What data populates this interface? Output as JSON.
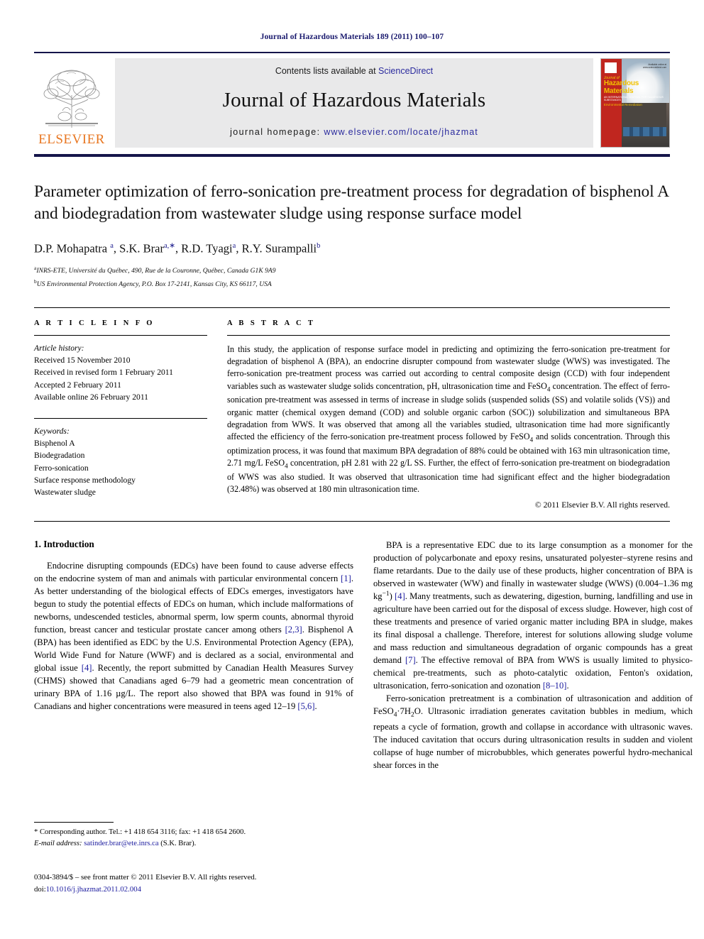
{
  "running_head": "Journal of Hazardous Materials 189 (2011) 100–107",
  "masthead": {
    "contents_prefix": "Contents lists available at ",
    "sciencedirect": "ScienceDirect",
    "journal_title": "Journal of Hazardous Materials",
    "homepage_prefix": "journal homepage:",
    "homepage_url": "www.elsevier.com/locate/jhazmat",
    "publisher": "ELSEVIER",
    "cover": {
      "line1": "Journal of",
      "line2": "Hazardous",
      "line3": "Materials",
      "line4": "AN INTERNATIONAL JOURNAL FOR HAZARDOUS SUBSTANCES",
      "line5": "Environmental Remediation",
      "corner_note": "Available online at www.sciencedirect.com"
    },
    "accent_blue": "#2b2b9e",
    "accent_orange": "#e87722",
    "rule_navy": "#15154a"
  },
  "article": {
    "title": "Parameter optimization of ferro-sonication pre-treatment process for degradation of bisphenol A and biodegradation from wastewater sludge using response surface model",
    "authors_html": "D.P. Mohapatra <sup>a</sup>, S.K. Brar<sup>a,∗</sup>, R.D. Tyagi<sup>a</sup>, R.Y. Surampalli<sup>b</sup>",
    "affiliations": [
      {
        "marker": "a",
        "text": "INRS-ETE, Université du Québec, 490, Rue de la Couronne, Québec, Canada G1K 9A9"
      },
      {
        "marker": "b",
        "text": "US Environmental Protection Agency, P.O. Box 17-2141, Kansas City, KS 66117, USA"
      }
    ]
  },
  "article_info": {
    "heading": "A R T I C L E  I N F O",
    "history_label": "Article history:",
    "history": [
      "Received 15 November 2010",
      "Received in revised form 1 February 2011",
      "Accepted 2 February 2011",
      "Available online 26 February 2011"
    ],
    "keywords_label": "Keywords:",
    "keywords": [
      "Bisphenol A",
      "Biodegradation",
      "Ferro-sonication",
      "Surface response methodology",
      "Wastewater sludge"
    ]
  },
  "abstract": {
    "heading": "A B S T R A C T",
    "text": "In this study, the application of response surface model in predicting and optimizing the ferro-sonication pre-treatment for degradation of bisphenol A (BPA), an endocrine disrupter compound from wastewater sludge (WWS) was investigated. The ferro-sonication pre-treatment process was carried out according to central composite design (CCD) with four independent variables such as wastewater sludge solids concentration, pH, ultrasonication time and FeSO4 concentration. The effect of ferro-sonication pre-treatment was assessed in terms of increase in sludge solids (suspended solids (SS) and volatile solids (VS)) and organic matter (chemical oxygen demand (COD) and soluble organic carbon (SOC)) solubilization and simultaneous BPA degradation from WWS. It was observed that among all the variables studied, ultrasonication time had more significantly affected the efficiency of the ferro-sonication pre-treatment process followed by FeSO4 and solids concentration. Through this optimization process, it was found that maximum BPA degradation of 88% could be obtained with 163 min ultrasonication time, 2.71 mg/L FeSO4 concentration, pH 2.81 with 22 g/L SS. Further, the effect of ferro-sonication pre-treatment on biodegradation of WWS was also studied. It was observed that ultrasonication time had significant effect and the higher biodegradation (32.48%) was observed at 180 min ultrasonication time.",
    "copyright": "© 2011 Elsevier B.V. All rights reserved."
  },
  "introduction": {
    "heading": "1.  Introduction",
    "left_paragraphs": [
      "Endocrine disrupting compounds (EDCs) have been found to cause adverse effects on the endocrine system of man and animals with particular environmental concern [1]. As better understanding of the biological effects of EDCs emerges, investigators have begun to study the potential effects of EDCs on human, which include malformations of newborns, undescended testicles, abnormal sperm, low sperm counts, abnormal thyroid function, breast cancer and testicular prostate cancer among others [2,3]. Bisphenol A (BPA) has been identified as EDC by the U.S. Environmental Protection Agency (EPA), World Wide Fund for Nature (WWF) and is declared as a social, environmental and global issue [4]. Recently, the report submitted by Canadian Health Measures Survey (CHMS) showed that Canadians aged 6–79 had a geometric mean concentration of urinary BPA of 1.16 µg/L. The report also showed that BPA was found in 91% of Canadians and higher concentrations were measured in teens aged 12–19 [5,6]."
    ],
    "right_paragraphs": [
      "BPA is a representative EDC due to its large consumption as a monomer for the production of polycarbonate and epoxy resins, unsaturated polyester–styrene resins and flame retardants. Due to the daily use of these products, higher concentration of BPA is observed in wastewater (WW) and finally in wastewater sludge (WWS) (0.004–1.36 mg kg−1) [4]. Many treatments, such as dewatering, digestion, burning, landfilling and use in agriculture have been carried out for the disposal of excess sludge. However, high cost of these treatments and presence of varied organic matter including BPA in sludge, makes its final disposal a challenge. Therefore, interest for solutions allowing sludge volume and mass reduction and simultaneous degradation of organic compounds has a great demand [7]. The effective removal of BPA from WWS is usually limited to physico-chemical pre-treatments, such as photo-catalytic oxidation, Fenton's oxidation, ultrasonication, ferro-sonication and ozonation [8–10].",
      "Ferro-sonication pretreatment is a combination of ultrasonication and addition of FeSO4·7H2O. Ultrasonic irradiation generates cavitation bubbles in medium, which repeats a cycle of formation, growth and collapse in accordance with ultrasonic waves. The induced cavitation that occurs during ultrasonication results in sudden and violent collapse of huge number of microbubbles, which generates powerful hydro-mechanical shear forces in the"
    ]
  },
  "footnotes": {
    "corresponding": "* Corresponding author. Tel.: +1 418 654 3116; fax: +1 418 654 2600.",
    "email_label": "E-mail address:",
    "email": "satinder.brar@ete.inrs.ca",
    "email_suffix": "(S.K. Brar).",
    "issn_line": "0304-3894/$ – see front matter © 2011 Elsevier B.V. All rights reserved.",
    "doi_label": "doi:",
    "doi": "10.1016/j.jhazmat.2011.02.004"
  }
}
